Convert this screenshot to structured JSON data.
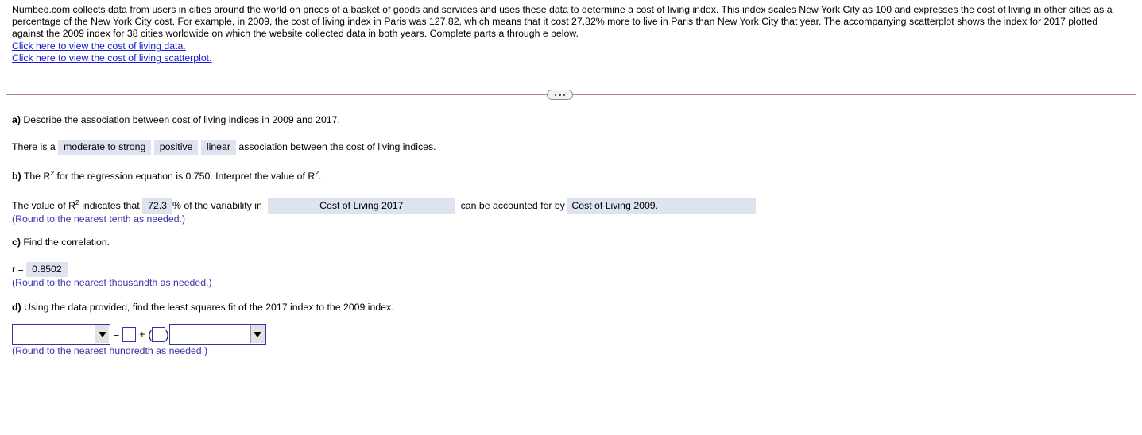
{
  "intro": {
    "paragraph": "Numbeo.com collects data from users in cities around the world on prices of a basket of goods and services and uses these data to determine a cost of living index. This index scales New York City as 100 and expresses the cost of living in other cities as a percentage of the New York City cost. For example, in 2009, the cost of living index in Paris was 127.82, which means that it cost 27.82% more to live in Paris than New York City that year. The accompanying scatterplot shows the index for 2017 plotted against the 2009 index for 38 cities worldwide on which the website collected data in both years. Complete parts a through e below.",
    "link_data": "Click here to view the cost of living data.",
    "link_scatterplot": "Click here to view the cost of living scatterplot."
  },
  "divider": {
    "ellipsis_dots": 3
  },
  "parts": {
    "a": {
      "label": "a)",
      "prompt": "Describe the association between cost of living indices in 2009 and 2017.",
      "sentence_start": "There is a",
      "answer_strength": "moderate to strong",
      "answer_direction": "positive",
      "answer_form": "linear",
      "sentence_end": "association between the cost of living indices."
    },
    "b": {
      "label": "b)",
      "prompt_start": "The R",
      "prompt_exponent": "2",
      "prompt_mid": "for the regression equation is",
      "r_squared_value": "0.750",
      "prompt_end": ". Interpret the value of R",
      "prompt_end_exponent": "2",
      "prompt_period": ".",
      "answer_start": "The value of R",
      "answer_exponent": "2",
      "answer_mid": "indicates that",
      "percent_value": "72.3",
      "percent_sign": "%",
      "answer_variability": "of the variability in",
      "response_variable": "Cost of Living 2017",
      "answer_accounted": "can be accounted for by",
      "predictor_variable": "Cost of Living 2009.",
      "hint": "(Round to the nearest tenth as needed.)"
    },
    "c": {
      "label": "c)",
      "prompt": "Find the correlation.",
      "r_label": "r =",
      "r_value": "0.8502",
      "hint": "(Round to the nearest thousandth as needed.)"
    },
    "d": {
      "label": "d)",
      "prompt": "Using the data provided, find the least squares fit of the 2017 index to the 2009 index.",
      "response_select_value": "",
      "equals": "=",
      "intercept_value": "",
      "plus": "+",
      "open_paren": "(",
      "slope_value": "",
      "close_paren": ")",
      "predictor_select_value": "",
      "hint": "(Round to the nearest hundredth as needed.)"
    }
  },
  "colors": {
    "link": "#1818d0",
    "hint": "#3a33a8",
    "answer_highlight": "#dde3ef",
    "input_border": "#3333aa",
    "divider_rule": "#b08494"
  }
}
